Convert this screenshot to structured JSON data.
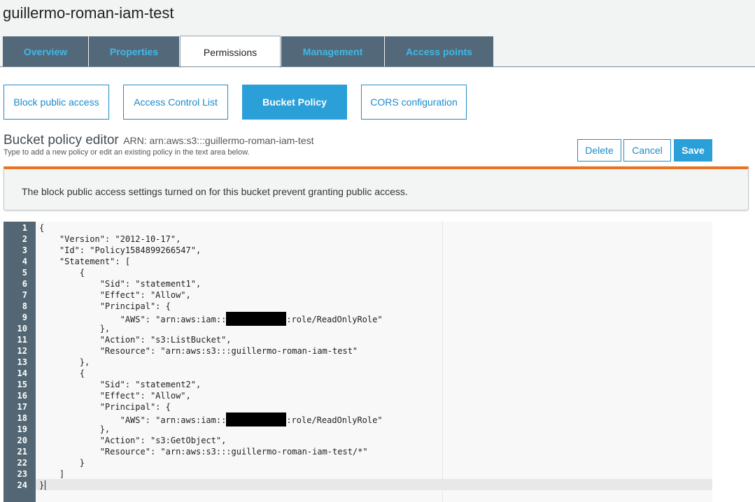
{
  "bucket": {
    "title": "guillermo-roman-iam-test"
  },
  "tabs": [
    {
      "label": "Overview"
    },
    {
      "label": "Properties"
    },
    {
      "label": "Permissions"
    },
    {
      "label": "Management"
    },
    {
      "label": "Access points"
    }
  ],
  "active_tab": "Permissions",
  "sub_tabs": [
    {
      "label": "Block public access"
    },
    {
      "label": "Access Control List"
    },
    {
      "label": "Bucket Policy"
    },
    {
      "label": "CORS configuration"
    }
  ],
  "active_sub_tab": "Bucket Policy",
  "editor": {
    "heading": "Bucket policy editor",
    "arn": "ARN: arn:aws:s3:::guillermo-roman-iam-test",
    "subtitle": "Type to add a new policy or edit an existing policy in the text area below."
  },
  "actions": {
    "delete": "Delete",
    "cancel": "Cancel",
    "save": "Save"
  },
  "warning": {
    "text": "The block public access settings turned on for this bucket prevent granting public access."
  },
  "code": {
    "line_numbers": [
      "1",
      "2",
      "3",
      "4",
      "5",
      "6",
      "7",
      "8",
      "9",
      "10",
      "11",
      "12",
      "13",
      "14",
      "15",
      "16",
      "17",
      "18",
      "19",
      "20",
      "21",
      "22",
      "23",
      "24"
    ],
    "lines": [
      "{",
      "    \"Version\": \"2012-10-17\",",
      "    \"Id\": \"Policy1584899266547\",",
      "    \"Statement\": [",
      "        {",
      "            \"Sid\": \"statement1\",",
      "            \"Effect\": \"Allow\",",
      "            \"Principal\": {",
      "                \"AWS\": \"arn:aws:iam::",
      "            },",
      "            \"Action\": \"s3:ListBucket\",",
      "            \"Resource\": \"arn:aws:s3:::guillermo-roman-iam-test\"",
      "        },",
      "        {",
      "            \"Sid\": \"statement2\",",
      "            \"Effect\": \"Allow\",",
      "            \"Principal\": {",
      "                \"AWS\": \"arn:aws:iam::",
      "            },",
      "            \"Action\": \"s3:GetObject\",",
      "            \"Resource\": \"arn:aws:s3:::guillermo-roman-iam-test/*\"",
      "        }",
      "    ]",
      "}"
    ],
    "line9_suffix": ":role/ReadOnlyRole\"",
    "line18_suffix": ":role/ReadOnlyRole\""
  }
}
